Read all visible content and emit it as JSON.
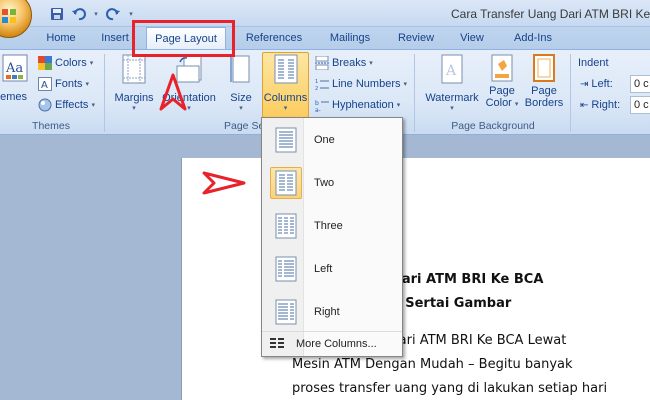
{
  "window": {
    "title": "Cara Transfer Uang Dari ATM BRI Ke BCA"
  },
  "tabs": [
    {
      "label": "Home"
    },
    {
      "label": "Insert"
    },
    {
      "label": "Page Layout",
      "active": true
    },
    {
      "label": "References"
    },
    {
      "label": "Mailings"
    },
    {
      "label": "Review"
    },
    {
      "label": "View"
    },
    {
      "label": "Add-Ins"
    }
  ],
  "ribbon": {
    "themes_group": {
      "themes_label": "hemes",
      "colors_label": "Colors",
      "fonts_label": "Fonts",
      "effects_label": "Effects",
      "group_label": "Themes"
    },
    "page_setup_group": {
      "margins_label": "Margins",
      "orientation_label": "Orientation",
      "size_label": "Size",
      "columns_label": "Columns",
      "breaks_label": "Breaks",
      "line_numbers_label": "Line Numbers",
      "hyphenation_label": "Hyphenation",
      "group_label": "Page Se"
    },
    "page_background_group": {
      "watermark_label": "Watermark",
      "page_color_label_1": "Page",
      "page_color_label_2": "Color",
      "page_borders_label_1": "Page",
      "page_borders_label_2": "Borders",
      "group_label": "Page Background"
    },
    "paragraph_group": {
      "indent_label": "Indent",
      "left_label": "Left:",
      "right_label": "Right:",
      "left_value": "0 c",
      "right_value": "0 c"
    }
  },
  "columns_menu": {
    "items": [
      {
        "label": "One",
        "selected": false
      },
      {
        "label": "Two",
        "selected": true
      },
      {
        "label": "Three",
        "selected": false
      },
      {
        "label": "Left",
        "selected": false
      },
      {
        "label": "Right",
        "selected": false
      }
    ],
    "more_columns_label": "More Columns..."
  },
  "document": {
    "heading_line1": "ng Dari ATM BRI Ke BCA",
    "heading_line2": "M Di Sertai Gambar",
    "body_line1": "ng Dari ATM BRI Ke BCA Lewat",
    "body_line2": "Mesin ATM Dengan Mudah – Begitu banyak",
    "body_line3": "proses transfer uang yang di lakukan setiap hari"
  },
  "colors": {
    "highlight_box": "#e8222a",
    "annotation_arrow": "#e8222a",
    "selected_item": "#fbd379"
  }
}
